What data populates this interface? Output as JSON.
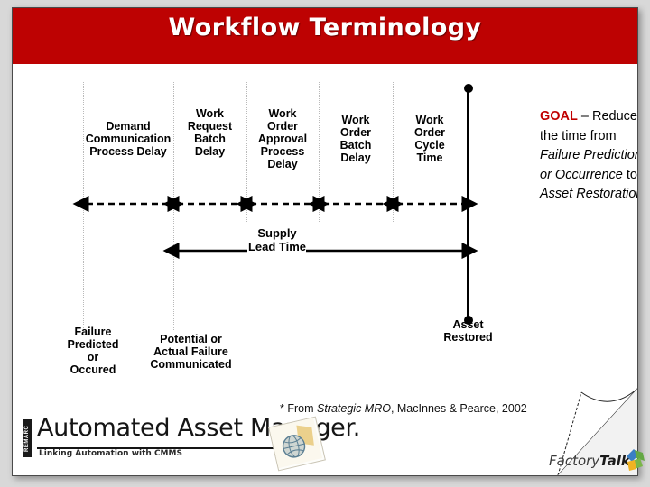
{
  "slide": {
    "title": "Workflow Terminology"
  },
  "diagram": {
    "segments": [
      {
        "id": "demand-communication-process-delay",
        "label": "Demand\nCommunication\nProcess Delay"
      },
      {
        "id": "work-request-batch-delay",
        "label": "Work\nRequest\nBatch\nDelay"
      },
      {
        "id": "work-order-approval-process-delay",
        "label": "Work\nOrder\nApproval\nProcess\nDelay"
      },
      {
        "id": "work-order-batch-delay",
        "label": "Work\nOrder\nBatch\nDelay"
      },
      {
        "id": "work-order-cycle-time",
        "label": "Work\nOrder\nCycle\nTime"
      }
    ],
    "supply_lead_time": "Supply\nLead Time",
    "milestones": [
      {
        "id": "failure-predicted-or-occured",
        "label": "Failure\nPredicted\nor\nOccured"
      },
      {
        "id": "potential-or-actual-failure-communicated",
        "label": "Potential or\nActual Failure\nCommunicated"
      },
      {
        "id": "asset-restored",
        "label": "Asset\nRestored"
      }
    ]
  },
  "goal": {
    "keyword": "GOAL",
    "dash": " – ",
    "text_1": "Reduce the time from ",
    "italic_1": "Failure Prediction or Occurrence",
    "text_2": " to ",
    "italic_2": "Asset Restoration"
  },
  "footnote": {
    "prefix": "* From ",
    "italic": "Strategic MRO",
    "suffix": ", MacInnes & Pearce, 2002"
  },
  "logos": {
    "aam": {
      "vertical_mark": "REMARC",
      "name": "Automated Asset Manager.",
      "tagline": "Linking Automation with CMMS"
    },
    "factorytalk": {
      "word_1": "Factory",
      "word_2": "Talk"
    }
  },
  "colors": {
    "banner_red": "#bd0202",
    "goal_red": "#c00000",
    "page_background": "#d8d8d8"
  }
}
